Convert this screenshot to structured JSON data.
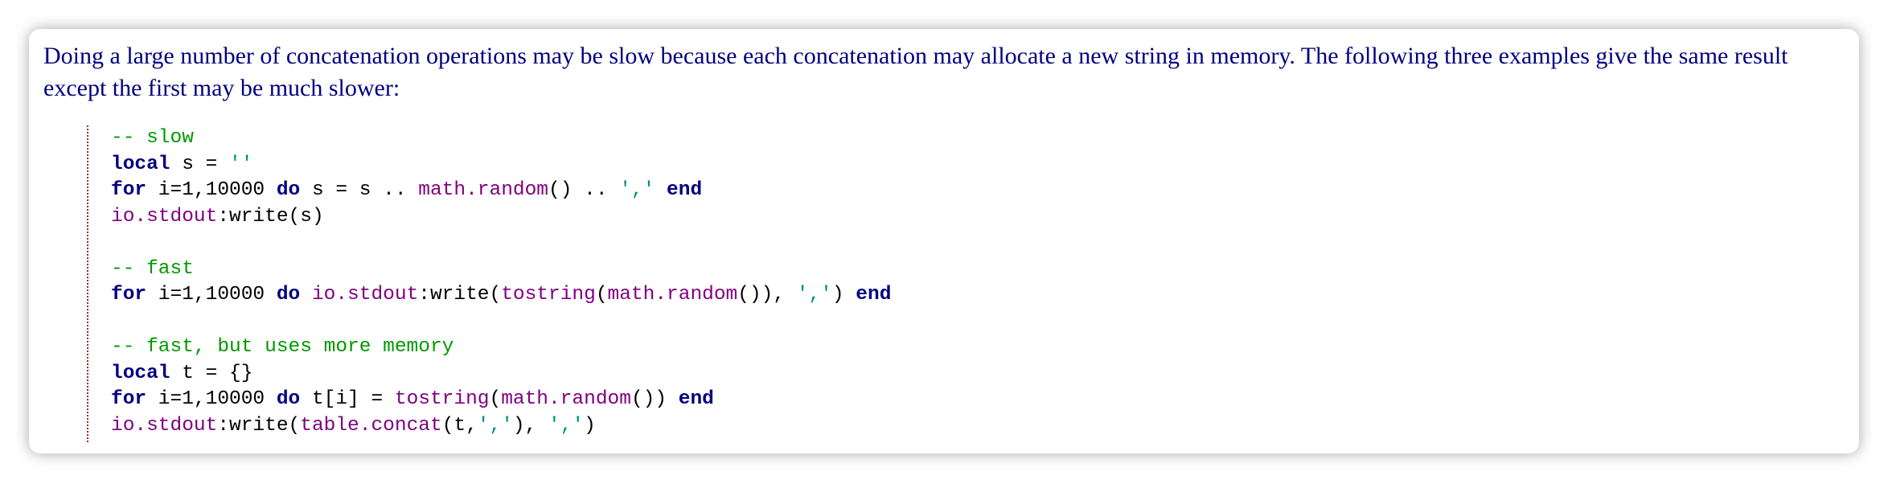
{
  "paragraph": "Doing a large number of concatenation operations may be slow because each concatenation may allocate a new string in memory. The following three examples give the same result except the first may be much slower:",
  "colors": {
    "text": "#000080",
    "comment": "#009900",
    "keyword": "#000080",
    "library": "#800080",
    "string": "#008b8b",
    "border": "#a52a2a"
  },
  "code": {
    "l1": {
      "comment": "-- slow"
    },
    "l2": {
      "kw": "local",
      "rest": " s = ",
      "str": "''"
    },
    "l3": {
      "kw1": "for",
      "a": " i=1,10000 ",
      "kw2": "do",
      "b": " s = s .. ",
      "lib": "math.random",
      "c": "() .. ",
      "str": "','",
      "d": " ",
      "kw3": "end"
    },
    "l4": {
      "lib": "io.stdout",
      "rest": ":write(s)"
    },
    "l6": {
      "comment": "-- fast"
    },
    "l7": {
      "kw1": "for",
      "a": " i=1,10000 ",
      "kw2": "do",
      "b": " ",
      "lib1": "io.stdout",
      "c": ":write(",
      "lib2": "tostring",
      "d": "(",
      "lib3": "math.random",
      "e": "()), ",
      "str": "','",
      "f": ") ",
      "kw3": "end"
    },
    "l9": {
      "comment": "-- fast, but uses more memory"
    },
    "l10": {
      "kw": "local",
      "rest": " t = {}"
    },
    "l11": {
      "kw1": "for",
      "a": " i=1,10000 ",
      "kw2": "do",
      "b": " t[i] = ",
      "lib1": "tostring",
      "c": "(",
      "lib2": "math.random",
      "d": "()) ",
      "kw3": "end"
    },
    "l12": {
      "lib1": "io.stdout",
      "a": ":write(",
      "lib2": "table.concat",
      "b": "(t,",
      "str1": "','",
      "c": "), ",
      "str2": "','",
      "d": ")"
    }
  }
}
